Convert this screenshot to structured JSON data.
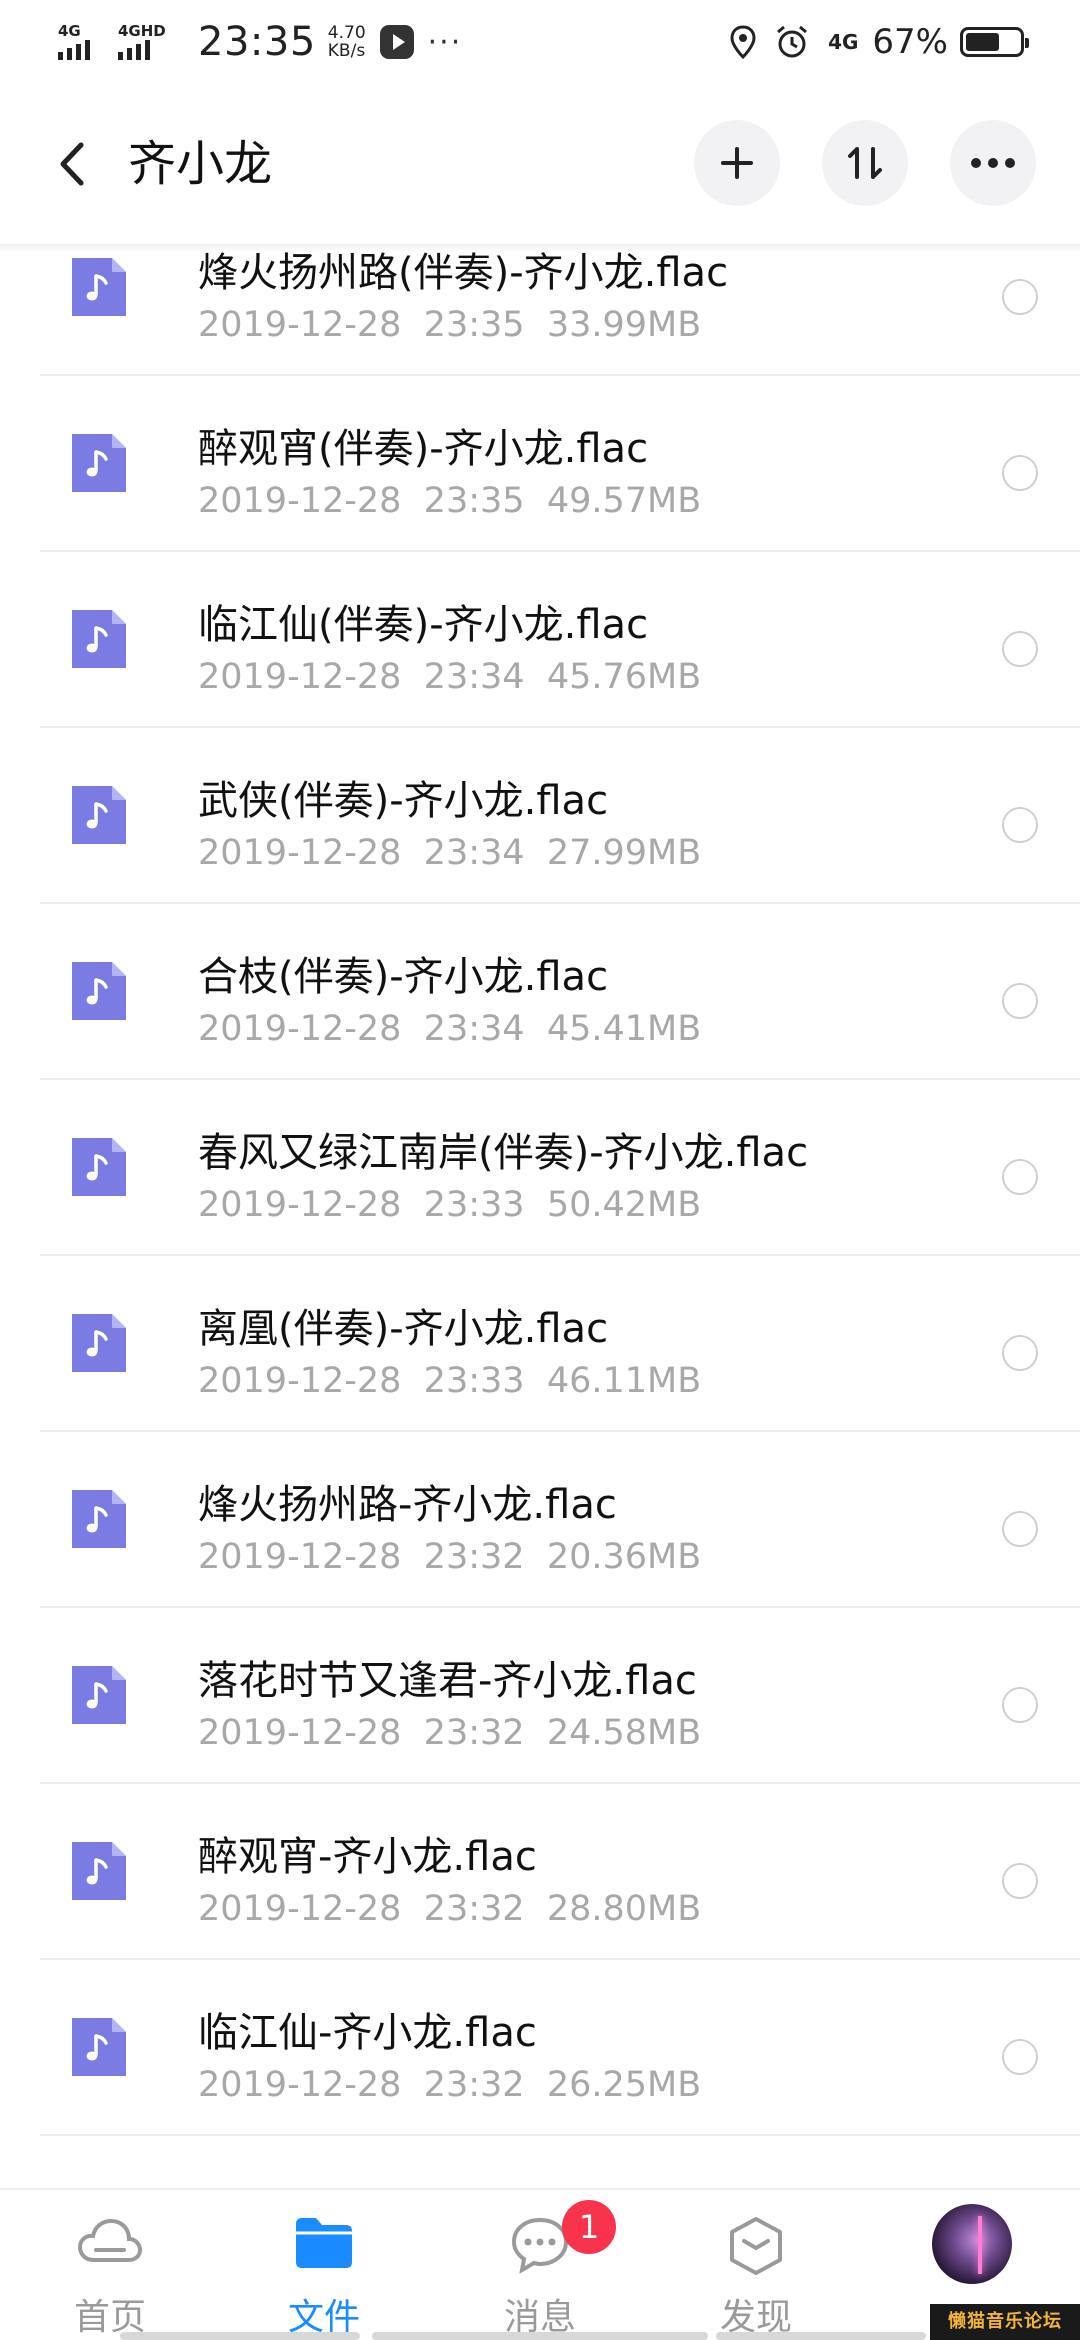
{
  "status_bar": {
    "network1": "4G",
    "network2": "4GHD",
    "time": "23:35",
    "speed_value": "4.70",
    "speed_unit": "KB/s",
    "more": "···",
    "data_label": "4G",
    "battery_percent": "67%",
    "battery_level": 0.67
  },
  "header": {
    "title": "齐小龙",
    "back_icon": "chevron-left-icon",
    "add_icon": "plus-icon",
    "sort_icon": "sort-icon",
    "more_icon": "more-horizontal-icon"
  },
  "files": [
    {
      "name": "烽火扬州路(伴奏)-齐小龙.flac",
      "date": "2019-12-28",
      "time": "23:35",
      "size": "33.99MB"
    },
    {
      "name": "醉观宵(伴奏)-齐小龙.flac",
      "date": "2019-12-28",
      "time": "23:35",
      "size": "49.57MB"
    },
    {
      "name": "临江仙(伴奏)-齐小龙.flac",
      "date": "2019-12-28",
      "time": "23:34",
      "size": "45.76MB"
    },
    {
      "name": "武侠(伴奏)-齐小龙.flac",
      "date": "2019-12-28",
      "time": "23:34",
      "size": "27.99MB"
    },
    {
      "name": "合枝(伴奏)-齐小龙.flac",
      "date": "2019-12-28",
      "time": "23:34",
      "size": "45.41MB"
    },
    {
      "name": "春风又绿江南岸(伴奏)-齐小龙.flac",
      "date": "2019-12-28",
      "time": "23:33",
      "size": "50.42MB"
    },
    {
      "name": "离凰(伴奏)-齐小龙.flac",
      "date": "2019-12-28",
      "time": "23:33",
      "size": "46.11MB"
    },
    {
      "name": "烽火扬州路-齐小龙.flac",
      "date": "2019-12-28",
      "time": "23:32",
      "size": "20.36MB"
    },
    {
      "name": "落花时节又逢君-齐小龙.flac",
      "date": "2019-12-28",
      "time": "23:32",
      "size": "24.58MB"
    },
    {
      "name": "醉观宵-齐小龙.flac",
      "date": "2019-12-28",
      "time": "23:32",
      "size": "28.80MB"
    },
    {
      "name": "临江仙-齐小龙.flac",
      "date": "2019-12-28",
      "time": "23:32",
      "size": "26.25MB"
    }
  ],
  "file_icon": "music-file-icon",
  "colors": {
    "file_icon": "#7b7ce3",
    "accent": "#1a8cff",
    "badge": "#f8334c",
    "inactive": "#9a9a9a",
    "meta_text": "#a8a8a8"
  },
  "bottom_nav": {
    "items": [
      {
        "label": "首页",
        "icon": "cloud-icon"
      },
      {
        "label": "文件",
        "icon": "folder-icon"
      },
      {
        "label": "消息",
        "icon": "chat-icon"
      },
      {
        "label": "发现",
        "icon": "cube-icon"
      }
    ],
    "active": "文件",
    "message_badge": "1"
  },
  "watermark": "懒猫音乐论坛"
}
